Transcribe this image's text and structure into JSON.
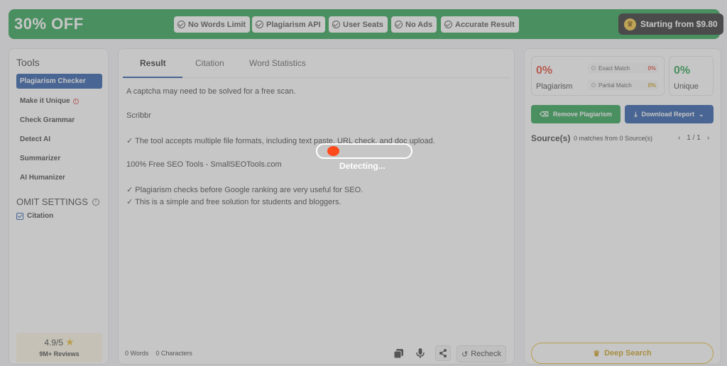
{
  "banner": {
    "discount": "30% OFF",
    "features": [
      "No Words Limit",
      "Plagiarism API",
      "User Seats",
      "No Ads",
      "Accurate Result"
    ],
    "price_label": "Starting from $9.80",
    "bg_color": "#1e9b45"
  },
  "sidebar": {
    "title": "Tools",
    "items": [
      {
        "label": "Plagiarism Checker",
        "active": true
      },
      {
        "label": "Make it Unique",
        "active": false
      },
      {
        "label": "Check Grammar",
        "active": false
      },
      {
        "label": "Detect AI",
        "active": false
      },
      {
        "label": "Summarizer",
        "active": false
      },
      {
        "label": "AI Humanizer",
        "active": false
      }
    ],
    "omit_title": "OMIT SETTINGS",
    "omit_option": "Citation",
    "rating": "4.9/5",
    "reviews": "9M+ Reviews"
  },
  "main": {
    "tabs": [
      {
        "label": "Result",
        "active": true
      },
      {
        "label": "Citation",
        "active": false
      },
      {
        "label": "Word Statistics",
        "active": false
      }
    ],
    "lines": [
      "A captcha may need to be solved for a free scan.",
      "Scribbr",
      "✓ The tool accepts multiple file formats, including text paste, URL check, and doc upload.",
      "100% Free SEO Tools - SmallSEOTools.com",
      "✓ Plagiarism checks before Google ranking are very useful for SEO.",
      "✓ This is a simple and free solution for students and bloggers."
    ],
    "word_count": "0 Words",
    "char_count": "0 Characters",
    "recheck_label": "Recheck"
  },
  "results": {
    "plagiarism_pct": "0%",
    "plagiarism_label": "Plagiarism",
    "exact_match_label": "Exact Match",
    "exact_match_pct": "0%",
    "partial_match_label": "Partial Match",
    "partial_match_pct": "0%",
    "unique_pct": "0%",
    "unique_label": "Unique",
    "remove_label": "Remove Plagiarism",
    "download_label": "Download Report",
    "sources_title": "Source(s)",
    "sources_count": "0 matches from 0 Source(s)",
    "page_indicator": "1 / 1",
    "deep_search_label": "Deep Search",
    "colors": {
      "plagiarism": "#e0402a",
      "unique": "#1e9b45",
      "partial": "#e8b820"
    }
  },
  "overlay": {
    "status": "Detecting..."
  }
}
